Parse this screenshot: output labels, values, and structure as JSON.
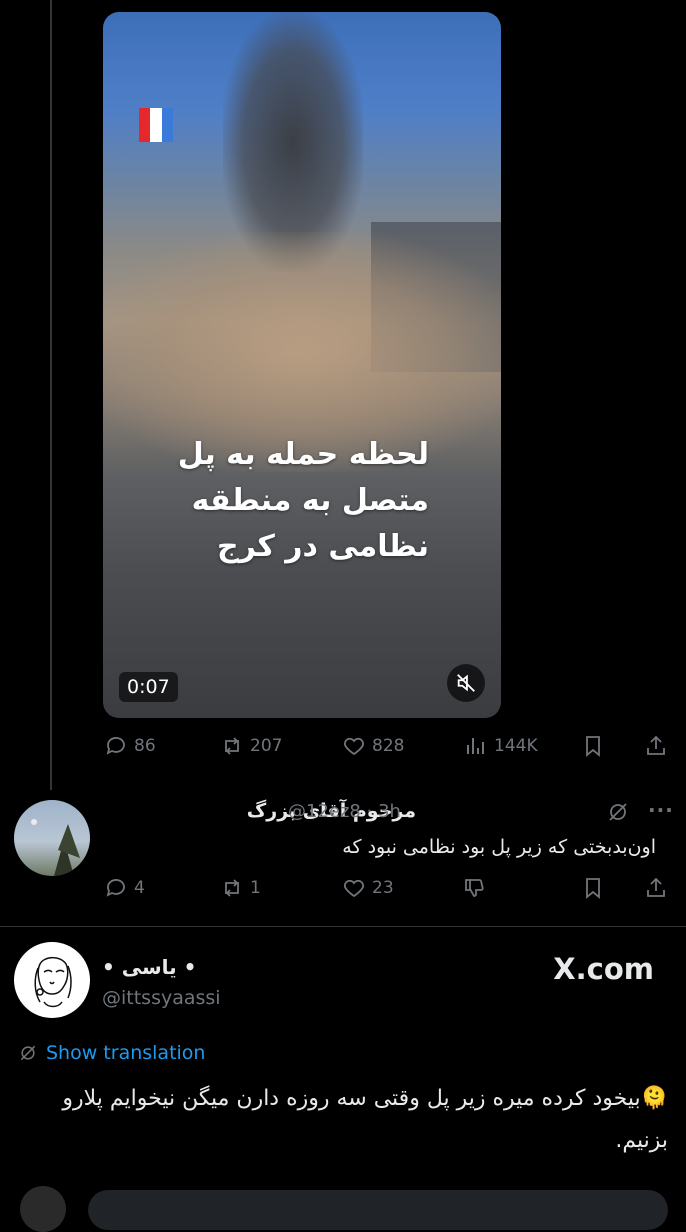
{
  "video": {
    "caption": "لحظه حمله به پل متصل به منطقه نظامی در کرج",
    "duration": "0:07"
  },
  "main_actions": {
    "replies": "86",
    "reposts": "207",
    "likes": "828",
    "views": "144K"
  },
  "reply": {
    "name": "مرحوم آقای بزرگ",
    "handle": "@12ez8",
    "time": "3h",
    "text": "اون‌بدبختی که زیر پل بود نظامی نبود که",
    "replies": "4",
    "reposts": "1",
    "likes": "23"
  },
  "quote": {
    "name": "• یاسی •",
    "handle": "@ittssyaassi",
    "brand": "X.com",
    "translate_label": "Show translation",
    "text": "🫠بیخود کرده میره زیر پل وقتی سه روزه دارن میگن نیخوایم پلارو بزنیم."
  },
  "colors": {
    "background": "#000000",
    "muted": "#71767b",
    "link": "#1d9bf0"
  }
}
